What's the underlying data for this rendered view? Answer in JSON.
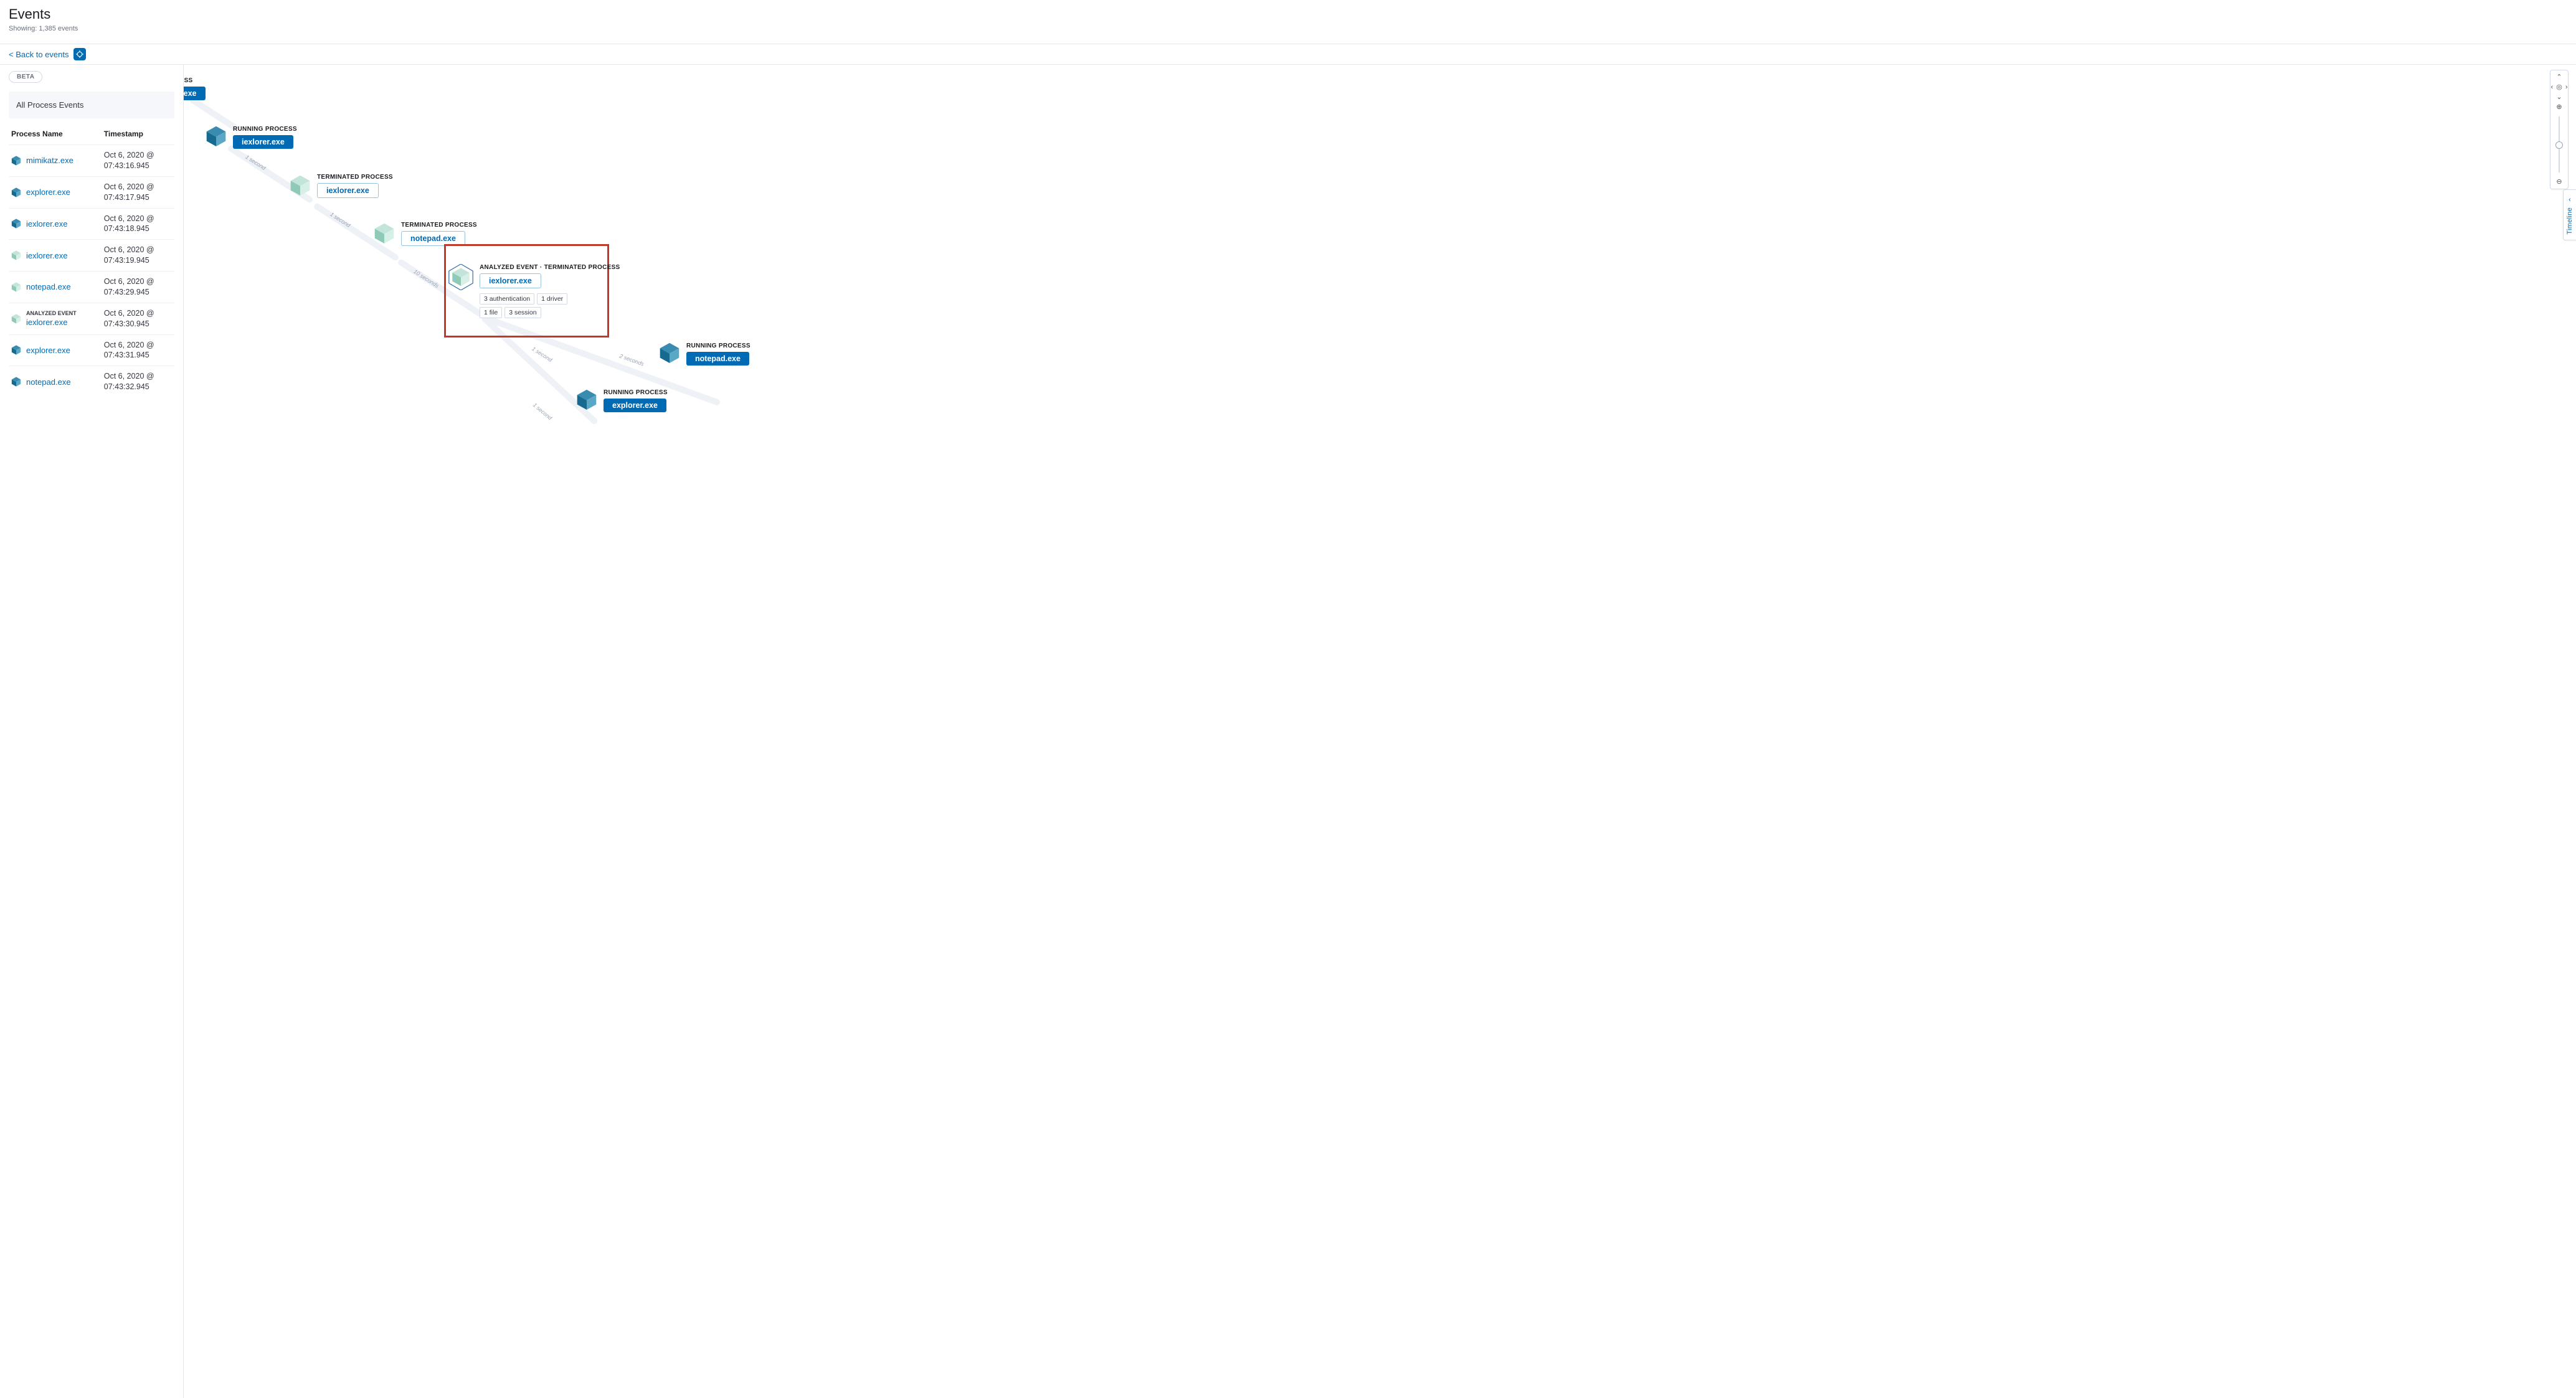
{
  "header": {
    "title": "Events",
    "showing_prefix": "Showing: ",
    "showing_count": "1,385 events",
    "back_link": "< Back to events"
  },
  "sidebar": {
    "beta": "BETA",
    "panel_title": "All Process Events",
    "col_process": "Process Name",
    "col_timestamp": "Timestamp",
    "rows": [
      {
        "name": "mimikatz.exe",
        "ts": "Oct 6, 2020 @ 07:43:16.945",
        "variant": "running"
      },
      {
        "name": "explorer.exe",
        "ts": "Oct 6, 2020 @ 07:43:17.945",
        "variant": "running"
      },
      {
        "name": "iexlorer.exe",
        "ts": "Oct 6, 2020 @ 07:43:18.945",
        "variant": "running"
      },
      {
        "name": "iexlorer.exe",
        "ts": "Oct 6, 2020 @ 07:43:19.945",
        "variant": "term"
      },
      {
        "name": "notepad.exe",
        "ts": "Oct 6, 2020 @ 07:43:29.945",
        "variant": "term"
      },
      {
        "name": "iexlorer.exe",
        "ts": "Oct 6, 2020 @ 07:43:30.945",
        "variant": "term",
        "analyzed": true,
        "analyzed_label": "ANALYZED EVENT"
      },
      {
        "name": "explorer.exe",
        "ts": "Oct 6, 2020 @ 07:43:31.945",
        "variant": "running"
      },
      {
        "name": "notepad.exe",
        "ts": "Oct 6, 2020 @ 07:43:32.945",
        "variant": "running"
      }
    ]
  },
  "graph": {
    "edges": {
      "e1": "1 second",
      "e2": "1 second",
      "e3": "10 seconds",
      "e4": "1 second",
      "e5": "2 seconds",
      "e6": "1 second"
    },
    "node0": {
      "status_partial": "OCESS",
      "pill_partial": "t.exe"
    },
    "node1": {
      "status": "RUNNING PROCESS",
      "pill": "iexlorer.exe"
    },
    "node2": {
      "status": "TERMINATED PROCESS",
      "pill": "iexlorer.exe"
    },
    "node3": {
      "status": "TERMINATED PROCESS",
      "pill": "notepad.exe"
    },
    "node4": {
      "status": "ANALYZED EVENT · TERMINATED PROCESS",
      "pill": "iexlorer.exe",
      "tags": [
        "3 authentication",
        "1 driver",
        "1 file",
        "3 session"
      ]
    },
    "node5": {
      "status": "RUNNING PROCESS",
      "pill": "notepad.exe"
    },
    "node6": {
      "status": "RUNNING PROCESS",
      "pill": "explorer.exe"
    }
  },
  "timeline_label": "Timeline"
}
